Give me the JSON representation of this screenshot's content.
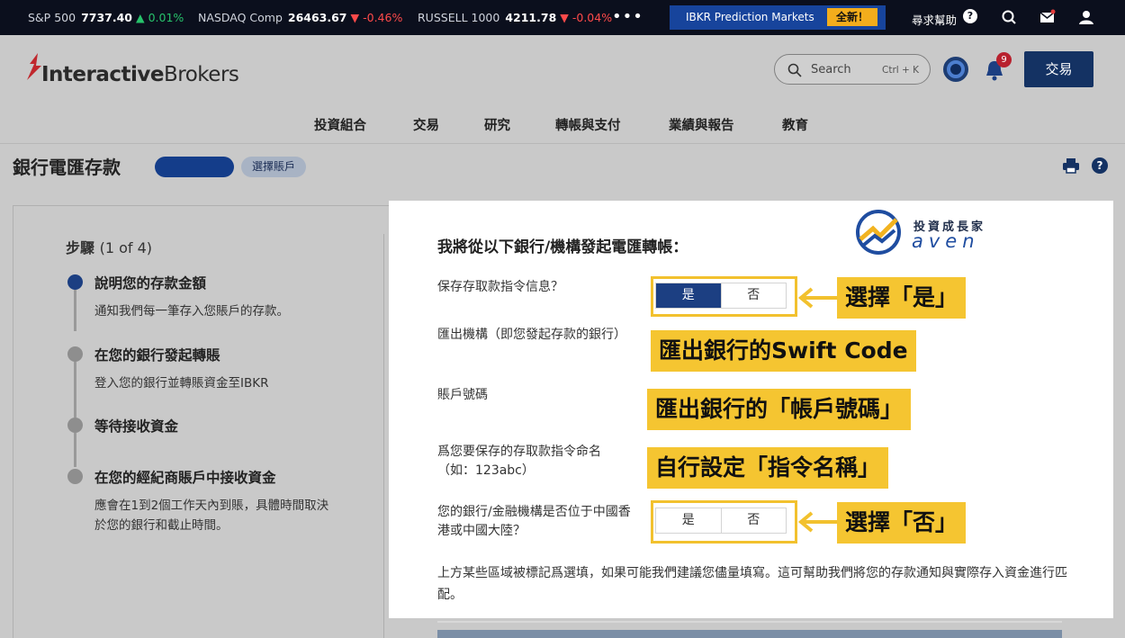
{
  "ticker": {
    "items": [
      {
        "name": "S&P 500",
        "value": "7737.40",
        "change": "▲ 0.01%",
        "dir": "up"
      },
      {
        "name": "NASDAQ Comp",
        "value": "26463.67",
        "change": "▼ -0.46%",
        "dir": "down"
      },
      {
        "name": "RUSSELL 1000",
        "value": "4211.78",
        "change": "▼ -0.04%",
        "dir": "down"
      }
    ],
    "more": "•••",
    "promo_label": "IBKR Prediction Markets",
    "promo_badge": "全新！",
    "help_label": "尋求幫助",
    "help_icon": "?",
    "icons": [
      "chat-icon",
      "mail-icon",
      "user-icon"
    ]
  },
  "header": {
    "logo_bold": "Interactive",
    "logo_rest": "Brokers",
    "search_placeholder": "Search",
    "search_shortcut": "Ctrl + K",
    "notification_count": "9",
    "trade_button": "交易",
    "nav": [
      "投資組合",
      "交易",
      "研究",
      "轉帳與支付",
      "業績與報告",
      "教育"
    ]
  },
  "page": {
    "title": "銀行電匯存款",
    "select_account": "選擇賬戶",
    "help_icon": "?"
  },
  "steps": {
    "title": "步驟",
    "progress": "(1 of 4)",
    "items": [
      {
        "title": "說明您的存款金額",
        "desc": "通知我們每一筆存入您賬戶的存款。"
      },
      {
        "title": "在您的銀行發起轉賬",
        "desc": "登入您的銀行並轉賬資金至IBKR"
      },
      {
        "title": "等待接收資金",
        "desc": ""
      },
      {
        "title": "在您的經紀商賬戶中接收資金",
        "desc": "應會在1到2個工作天內到賬，具體時間取決於您的銀行和截止時間。"
      }
    ]
  },
  "form": {
    "heading": "我將從以下銀行/機構發起電匯轉帳：",
    "save_label": "保存存取款指令信息？",
    "save_yes": "是",
    "save_no": "否",
    "institution_label": "匯出機構（即您發起存款的銀行）",
    "account_label": "賬戶號碼",
    "name_label": "爲您要保存的存取款指令命名（如：123abc）",
    "china_label": "您的銀行/金融機構是否位于中國香港或中國大陸？",
    "china_yes": "是",
    "china_no": "否",
    "note": "上方某些區域被標記爲選填，如果可能我們建議您儘量填寫。這可幫助我們將您的存款通知與實際存入資金進行匹配。"
  },
  "annotations": {
    "pick_yes": "選擇「是」",
    "swift": "匯出銀行的Swift Code",
    "account": "匯出銀行的「帳戶號碼」",
    "name": "自行設定「指令名稱」",
    "pick_no": "選擇「否」"
  },
  "brand": {
    "cn": "投資成長家",
    "en": "aven"
  },
  "colors": {
    "accent": "#1c3f82",
    "highlight": "#f5c531",
    "ticker_bg": "#0b0f1d"
  }
}
